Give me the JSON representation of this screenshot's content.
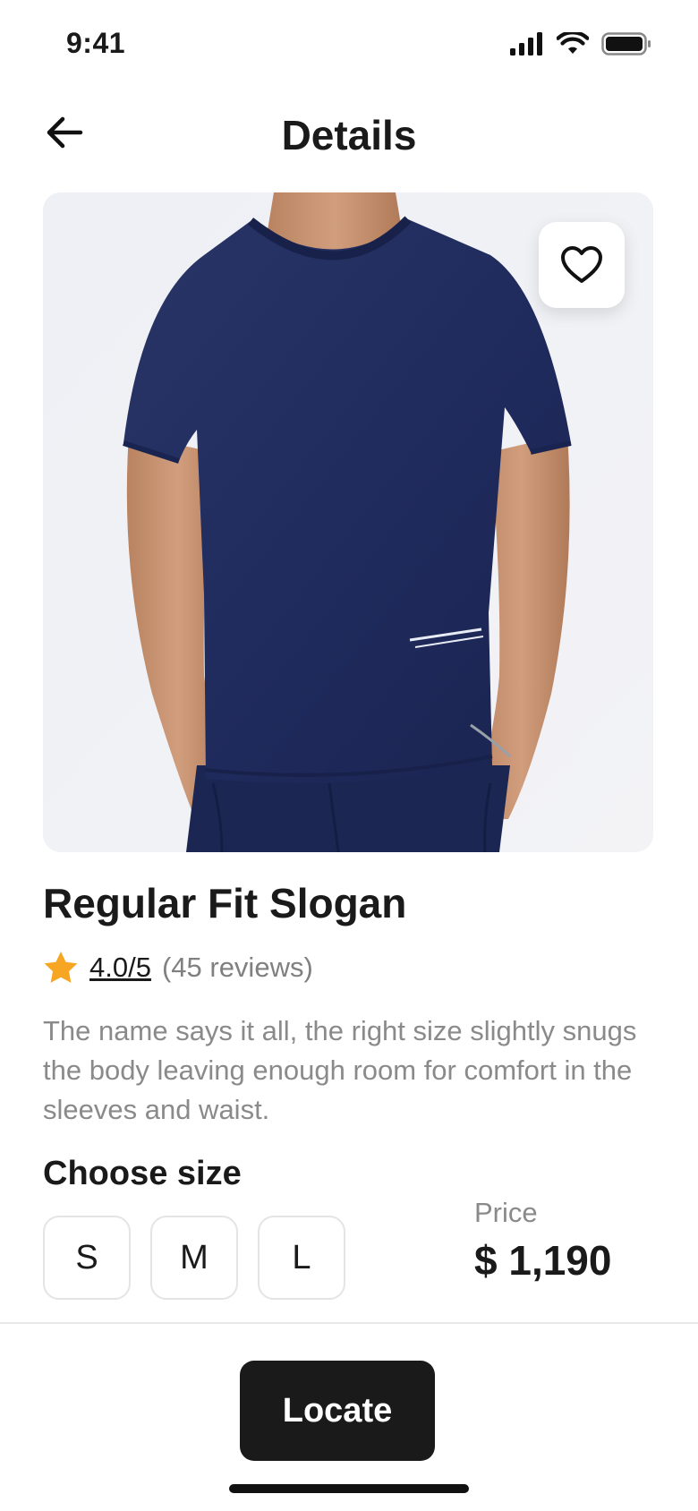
{
  "status_bar": {
    "time": "9:41"
  },
  "header": {
    "title": "Details"
  },
  "product": {
    "name": "Regular Fit Slogan",
    "rating": "4.0/5",
    "reviews": "(45 reviews)",
    "description": "The name says it all, the right size slightly snugs the body leaving enough room for comfort in the sleeves and waist."
  },
  "size": {
    "title": "Choose size",
    "options": [
      "S",
      "M",
      "L"
    ]
  },
  "price": {
    "label": "Price",
    "value": "$ 1,190"
  },
  "actions": {
    "locate_label": "Locate"
  },
  "colors": {
    "primary": "#1a1a1a",
    "shirt": "#1f2a5c",
    "star": "#f6a623",
    "muted_text": "#8a8a8a"
  },
  "icons": {
    "back": "arrow-left-icon",
    "favorite": "heart-icon",
    "rating": "star-icon"
  }
}
